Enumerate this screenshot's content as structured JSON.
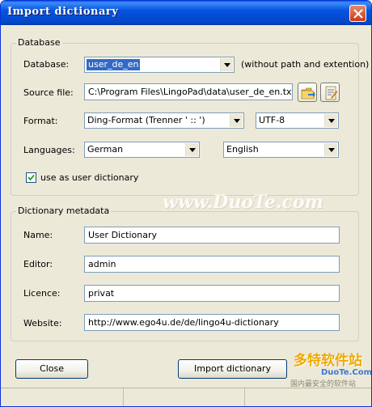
{
  "window": {
    "title": "Import dictionary"
  },
  "database_group": {
    "legend": "Database",
    "database_label": "Database:",
    "database_value": "user_de_en",
    "database_hint": "(without path and extention)",
    "source_label": "Source file:",
    "source_value": "C:\\Program Files\\LingoPad\\data\\user_de_en.txt",
    "format_label": "Format:",
    "format_value": "Ding-Format (Trenner ' :: ')",
    "encoding_value": "UTF-8",
    "languages_label": "Languages:",
    "language_from": "German",
    "language_to": "English",
    "user_dict_label": "use as user dictionary",
    "user_dict_checked": true
  },
  "metadata_group": {
    "legend": "Dictionary metadata",
    "name_label": "Name:",
    "name_value": "User Dictionary",
    "editor_label": "Editor:",
    "editor_value": "admin",
    "licence_label": "Licence:",
    "licence_value": "privat",
    "website_label": "Website:",
    "website_value": "http://www.ego4u.de/de/lingo4u-dictionary"
  },
  "buttons": {
    "close": "Close",
    "import": "Import dictionary"
  },
  "watermark": {
    "main": "www.DuoTe.com",
    "logo_cn": "多特软件站",
    "logo_en": "DuoTe.Com",
    "logo_sub": "国内最安全的软件站"
  },
  "icons": {
    "close": "close-icon",
    "open_folder": "open-folder-icon",
    "edit": "edit-file-icon",
    "dropdown": "chevron-down-icon",
    "check": "check-icon"
  },
  "colors": {
    "title_bar": "#0553e0",
    "window_bg": "#ece9d8",
    "close_button": "#c93a14",
    "selection": "#316ac5",
    "watermark": "#f0a800"
  }
}
